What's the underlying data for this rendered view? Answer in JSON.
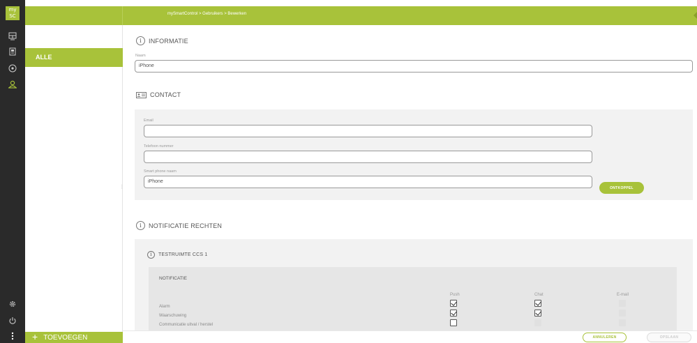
{
  "app": {
    "logo_text": "my\nSC",
    "breadcrumb": "mySmartControl > Gebruikers > Bewerken",
    "accent": "#a8c23a",
    "rail_color": "#2a2a2a"
  },
  "rail": {
    "icons": [
      "dashboard-icon",
      "device-icon",
      "target-icon",
      "users-icon",
      "settings-icon",
      "power-icon",
      "menu-dots-icon"
    ]
  },
  "sidebar": {
    "filter_label": "ALLE",
    "add_label": "TOEVOEGEN",
    "add_symbol": "+"
  },
  "info_section": {
    "title": "INFORMATIE",
    "name_label": "Naam",
    "name_value": "iPhone"
  },
  "contact_section": {
    "title": "CONTACT",
    "email_label": "Email",
    "email_value": "",
    "phone_label": "Telefoon nummer",
    "phone_value": "",
    "smartphone_label": "Smart phone naam",
    "smartphone_value": "iPhone",
    "disconnect_label": "ONTKOPPEL"
  },
  "notif_section": {
    "title": "NOTIFICATIE RECHTEN",
    "room_title": "TESTRUIMTE CCS 1",
    "table_title": "NOTIFICATIE",
    "columns": [
      "Push",
      "Chat",
      "E-mail"
    ],
    "rows": [
      {
        "label": "Alarm",
        "push": true,
        "chat": true,
        "email": null
      },
      {
        "label": "Waarschuwing",
        "push": true,
        "chat": true,
        "email": null
      },
      {
        "label": "Communicatie uitval / herstel",
        "push": false,
        "chat": null,
        "email": null
      }
    ]
  },
  "footer": {
    "cancel_label": "ANNULEREN",
    "save_label": "OPSLAAN"
  }
}
